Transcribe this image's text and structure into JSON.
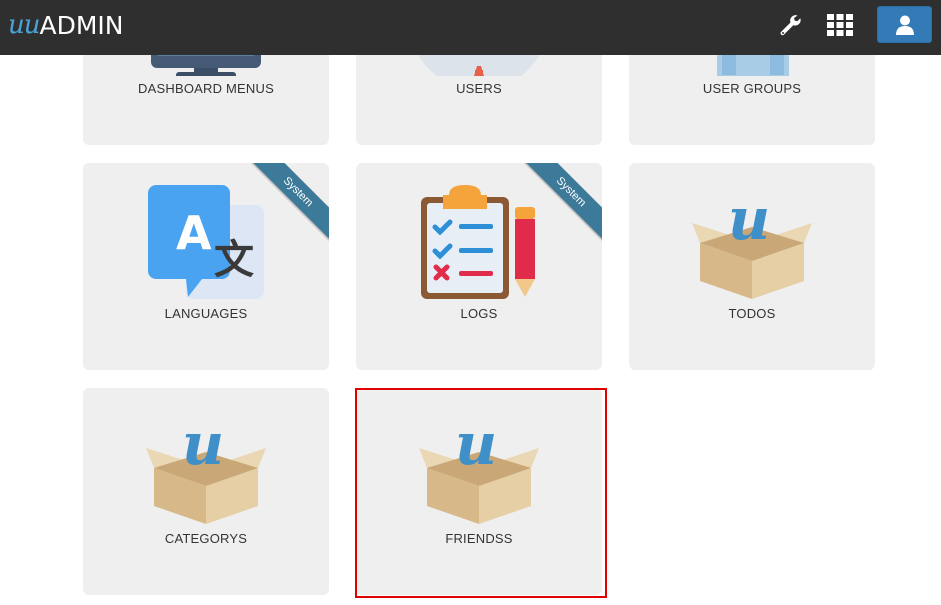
{
  "navbar": {
    "logo_mark": "u",
    "logo_text": "ADMIN",
    "wrench_icon": "wrench-icon",
    "apps_icon": "grid-icon",
    "user_icon": "user-icon",
    "bg_color": "#2f2f2f",
    "user_button_color": "#337ab7"
  },
  "tiles": [
    {
      "label": "DASHBOARD MENUS",
      "icon": "monitor-icon"
    },
    {
      "label": "USERS",
      "icon": "users-icon"
    },
    {
      "label": "USER GROUPS",
      "icon": "user-groups-icon"
    },
    {
      "label": "LANGUAGES",
      "icon": "translate-icon",
      "ribbon": "System"
    },
    {
      "label": "LOGS",
      "icon": "clipboard-checklist-icon",
      "ribbon": "System"
    },
    {
      "label": "TODOS",
      "icon": "box-icon"
    },
    {
      "label": "CATEGORYS",
      "icon": "box-icon"
    },
    {
      "label": "FRIENDSS",
      "icon": "box-icon"
    }
  ],
  "colors": {
    "tile_bg": "#efefef",
    "ribbon": "#3d7a99",
    "highlight": "#e00000"
  }
}
